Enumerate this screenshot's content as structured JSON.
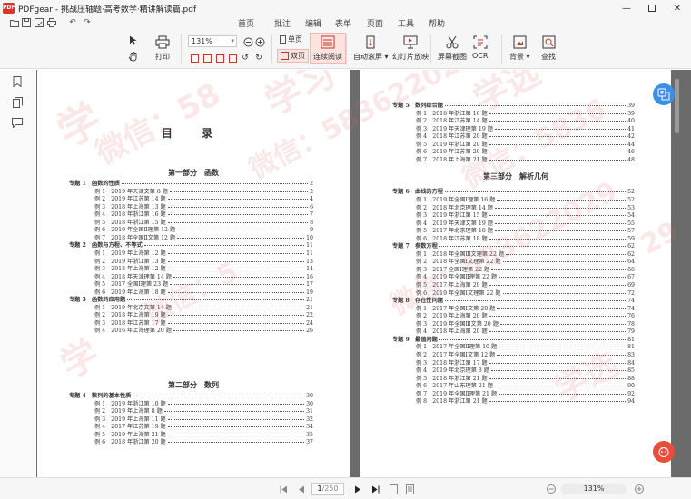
{
  "window": {
    "title": "PDFgear - 挑战压轴题·高考数学·精讲解读篇.pdf",
    "logo_text": "PDF"
  },
  "menu": {
    "tabs": [
      "首页",
      "批注",
      "编辑",
      "表单",
      "页面",
      "工具",
      "帮助"
    ],
    "active_tab": 0
  },
  "toolbar": {
    "print_label": "打印",
    "zoom_value": "131%",
    "single_page_label": "单页",
    "double_page_label": "双页",
    "continuous_label": "连续阅读",
    "auto_scroll_label": "自动滚屏",
    "slideshow_label": "幻灯片放映",
    "screenshot_label": "屏幕截图",
    "ocr_label": "OCR",
    "background_label": "背景",
    "search_label": "查找"
  },
  "colors": {
    "accent": "#c0392b",
    "float_blue": "#3d8ee6",
    "float_red": "#e94d3c"
  },
  "document": {
    "left_page": {
      "title": "目 录",
      "sections": [
        {
          "part_title": "第一部分　函数",
          "topics": [
            {
              "label": "专题 1　函数的性质",
              "page": "2",
              "items": [
                {
                  "label": "例 1　2019 年天津文第 8 题",
                  "page": "2"
                },
                {
                  "label": "例 2　2019 年江苏第 14 题",
                  "page": "4"
                },
                {
                  "label": "例 3　2018 年上海第 13 题",
                  "page": "6"
                },
                {
                  "label": "例 4　2018 年浙江第 16 题",
                  "page": "7"
                },
                {
                  "label": "例 5　2018 年浙江第 15 题",
                  "page": "8"
                },
                {
                  "label": "例 6　2019 年全国Ⅱ理第 12 题",
                  "page": "9"
                },
                {
                  "label": "例 7　2018 年全国Ⅱ文第 12 题",
                  "page": "10"
                }
              ]
            },
            {
              "label": "专题 2　函数与方程、不等式",
              "page": "11",
              "items": [
                {
                  "label": "例 1　2019 年上海第 12 题",
                  "page": "11"
                },
                {
                  "label": "例 2　2019 年浙江第 13 题",
                  "page": "13"
                },
                {
                  "label": "例 3　2018 年上海第 12 题",
                  "page": "14"
                },
                {
                  "label": "例 4　2018 年天津理第 14 题",
                  "page": "16"
                },
                {
                  "label": "例 5　2017 全国Ⅰ理第 23 题",
                  "page": "17"
                },
                {
                  "label": "例 6　2019 年上海第 18 题",
                  "page": "19"
                }
              ]
            },
            {
              "label": "专题 3　函数的应用题",
              "page": "21",
              "items": [
                {
                  "label": "例 1　2019 年北京文第 14 题",
                  "page": "21"
                },
                {
                  "label": "例 2　2018 年上海第 19 题",
                  "page": "22"
                },
                {
                  "label": "例 3　2018 年江苏第 17 题",
                  "page": "24"
                },
                {
                  "label": "例 4　2016 年上海理第 20 题",
                  "page": "26"
                }
              ]
            }
          ]
        },
        {
          "part_title": "第二部分　数列",
          "topics": [
            {
              "label": "专题 4　数列的基本性质",
              "page": "30",
              "items": [
                {
                  "label": "例 1　2019 年浙江第 10 题",
                  "page": "30"
                },
                {
                  "label": "例 2　2019 年上海第 8 题",
                  "page": "31"
                },
                {
                  "label": "例 3　2019 年上海第 11 题",
                  "page": "32"
                },
                {
                  "label": "例 4　2017 年江苏第 19 题",
                  "page": "34"
                },
                {
                  "label": "例 5　2019 年上海第 21 题",
                  "page": "35"
                },
                {
                  "label": "例 6　2018 年浙江第 20 题",
                  "page": "37"
                }
              ]
            }
          ]
        }
      ]
    },
    "right_page": {
      "blocks": [
        {
          "type": "topic",
          "label": "专题 5　数列综合题",
          "page": "39",
          "items": [
            {
              "label": "例 1　2018 年浙江第 10 题",
              "page": "39"
            },
            {
              "label": "例 2　2018 年江苏第 14 题",
              "page": "40"
            },
            {
              "label": "例 3　2019 年天津理第 19 题",
              "page": "41"
            },
            {
              "label": "例 4　2018 年江苏第 20 题",
              "page": "42"
            },
            {
              "label": "例 5　2019 年浙江第 20 题",
              "page": "44"
            },
            {
              "label": "例 6　2019 年江苏第 20 题",
              "page": "46"
            },
            {
              "label": "例 7　2018 年上海第 21 题",
              "page": "48"
            }
          ]
        },
        {
          "type": "part",
          "label": "第三部分　解析几何"
        },
        {
          "type": "topic",
          "label": "专题 6　曲线的方程",
          "page": "52",
          "items": [
            {
              "label": "例 1　2019 年全国Ⅰ理第 16 题",
              "page": "52"
            },
            {
              "label": "例 2　2018 年北京理第 14 题",
              "page": "53"
            },
            {
              "label": "例 3　2019 年浙江第 15 题",
              "page": "54"
            },
            {
              "label": "例 4　2019 年天津文第 19 题",
              "page": "55"
            },
            {
              "label": "例 5　2017 年北京理第 18 题",
              "page": "57"
            },
            {
              "label": "例 6　2018 年江苏第 18 题",
              "page": "59"
            }
          ]
        },
        {
          "type": "topic",
          "label": "专题 7　参数方程",
          "page": "62",
          "items": [
            {
              "label": "例 1　2018 年全国Ⅲ文理第 22 题",
              "page": "62"
            },
            {
              "label": "例 2　2018 年全国Ⅰ文理第 22 题",
              "page": "64"
            },
            {
              "label": "例 3　2017 全国Ⅰ理第 22 题",
              "page": "66"
            },
            {
              "label": "例 4　2019 年全国Ⅱ理第 22 题",
              "page": "67"
            },
            {
              "label": "例 5　2017 年上海第 20 题",
              "page": "69"
            },
            {
              "label": "例 6　2019 年全国Ⅰ文理第 22 题",
              "page": "72"
            }
          ]
        },
        {
          "type": "topic",
          "label": "专题 8　存在性问题",
          "page": "74",
          "items": [
            {
              "label": "例 1　2017 年全国Ⅰ文第 20 题",
              "page": "74"
            },
            {
              "label": "例 2　2019 年上海第 20 题",
              "page": "76"
            },
            {
              "label": "例 3　2019 年全国Ⅲ文第 20 题",
              "page": "78"
            },
            {
              "label": "例 4　2018 年上海第 20 题",
              "page": "79"
            }
          ]
        },
        {
          "type": "topic",
          "label": "专题 9　最值问题",
          "page": "81",
          "items": [
            {
              "label": "例 1　2017 年全国Ⅱ理第 10 题",
              "page": "81"
            },
            {
              "label": "例 2　2017 年全国Ⅰ文第 12 题",
              "page": "83"
            },
            {
              "label": "例 3　2018 年浙江第 17 题",
              "page": "84"
            },
            {
              "label": "例 4　2019 年北京理第 8 题",
              "page": "85"
            },
            {
              "label": "例 5　2018 年浙江第 21 题",
              "page": "88"
            },
            {
              "label": "例 6　2017 年山东理第 21 题",
              "page": "90"
            },
            {
              "label": "例 7　2019 年全国Ⅱ理第 21 题",
              "page": "92"
            },
            {
              "label": "例 8　2018 年浙江第 21 题",
              "page": "94"
            }
          ]
        }
      ]
    }
  },
  "watermark": {
    "items": [
      "学",
      "微信：58",
      "学习",
      "微信：583622029",
      "学选",
      "微信：5836",
      "微信：5",
      "学",
      "微信：583622029",
      "学选",
      "29"
    ]
  },
  "status": {
    "current_page": "1",
    "total_pages": "/250",
    "zoom": "131%"
  }
}
